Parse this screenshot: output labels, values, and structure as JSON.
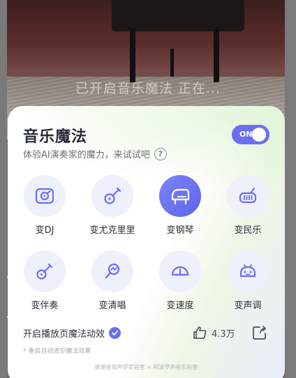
{
  "banner": {
    "status_text": "已开启音乐魔法   正在..."
  },
  "panel": {
    "title": "音乐魔法",
    "subtitle": "体验AI演奏家的魔力，来试试吧",
    "toggle": {
      "label": "ON",
      "state": "on",
      "color": "#6a6ff0"
    }
  },
  "effects": [
    {
      "label": "变DJ",
      "icon": "dj-icon",
      "selected": false
    },
    {
      "label": "变尤克里里",
      "icon": "ukulele-icon",
      "selected": false
    },
    {
      "label": "变钢琴",
      "icon": "piano-icon",
      "selected": true
    },
    {
      "label": "变民乐",
      "icon": "folk-instrument-icon",
      "selected": false
    },
    {
      "label": "变伴奏",
      "icon": "guitar-icon",
      "selected": false
    },
    {
      "label": "变清唱",
      "icon": "microphone-icon",
      "selected": false
    },
    {
      "label": "变速度",
      "icon": "speedometer-icon",
      "selected": false
    },
    {
      "label": "变声调",
      "icon": "robot-voice-icon",
      "selected": false
    }
  ],
  "footer": {
    "animation_option": "开启播放页魔法动效",
    "animation_checked": true,
    "like_count": "4.3万",
    "note": "* 重启自动清空魔法效果",
    "credit": "感谢音效声学实验室 × 阿波罗声音实验室"
  },
  "colors": {
    "accent": "#6a6ff0",
    "icon_bg": "#eef0fb",
    "text": "#2d2f3a"
  }
}
